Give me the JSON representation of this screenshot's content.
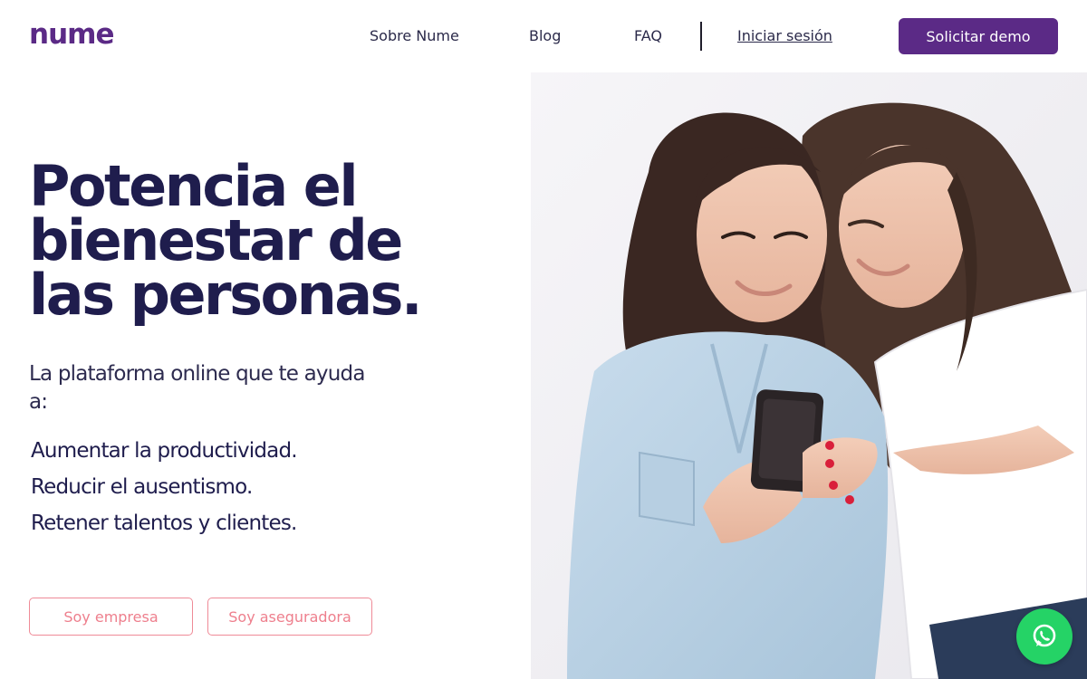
{
  "header": {
    "logo_text": "nume",
    "nav": {
      "about": "Sobre Nume",
      "blog": "Blog",
      "faq": "FAQ",
      "login": "Iniciar sesión"
    },
    "demo_button": "Solicitar demo"
  },
  "hero": {
    "title_lines": [
      "Potencia el",
      "bienestar de",
      "las personas."
    ],
    "subtitle": "La plataforma online que te ayuda a:",
    "benefits": [
      "Aumentar la productividad.",
      "Reducir el ausentismo.",
      "Retener talentos y clientes."
    ],
    "buttons": {
      "company": "Soy empresa",
      "insurer": "Soy aseguradora"
    }
  },
  "colors": {
    "brand_purple": "#5b2a86",
    "heading_navy": "#1f1d4d",
    "cta_pink": "#ee7f8d",
    "whatsapp_green": "#25d366"
  },
  "icons": {
    "floating": "whatsapp-icon"
  }
}
